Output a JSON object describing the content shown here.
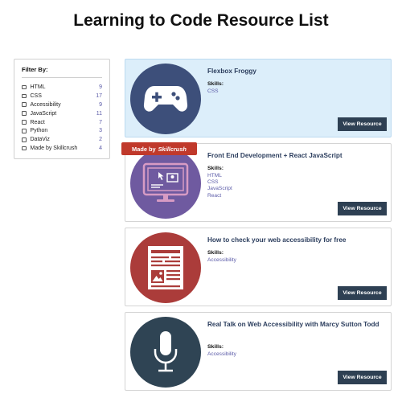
{
  "page": {
    "title": "Learning to Code Resource List"
  },
  "filter": {
    "title": "Filter By:",
    "items": [
      {
        "label": "HTML",
        "count": "9"
      },
      {
        "label": "CSS",
        "count": "17"
      },
      {
        "label": "Accessibility",
        "count": "9"
      },
      {
        "label": "JavaScript",
        "count": "11"
      },
      {
        "label": "React",
        "count": "7"
      },
      {
        "label": "Python",
        "count": "3"
      },
      {
        "label": "DataViz",
        "count": "2"
      },
      {
        "label": "Made by Skillcrush",
        "count": "4"
      }
    ]
  },
  "badge": {
    "prefix": "Made by",
    "brand": "Skillcrush"
  },
  "resources": [
    {
      "title": "Flexbox Froggy",
      "skills_heading": "Skills:",
      "skills": [
        "CSS"
      ],
      "button": "View Resource",
      "icon": "gamepad-icon",
      "icon_color": "#3d4f7a"
    },
    {
      "title": "Front End Development + React JavaScript",
      "skills_heading": "Skills:",
      "skills": [
        "HTML",
        "CSS",
        "JavaScript",
        "React"
      ],
      "button": "View Resource",
      "icon": "monitor-icon",
      "icon_color": "#6f5aa0"
    },
    {
      "title": "How to check your web accessibility for free",
      "skills_heading": "Skills:",
      "skills": [
        "Accessibility"
      ],
      "button": "View Resource",
      "icon": "document-icon",
      "icon_color": "#ab3c3a"
    },
    {
      "title": "Real Talk on Web Accessibility with Marcy Sutton Todd",
      "skills_heading": "Skills:",
      "skills": [
        "Accessibility"
      ],
      "button": "View Resource",
      "icon": "microphone-icon",
      "icon_color": "#2f4454"
    }
  ],
  "colors": {
    "highlight": "#dceefa",
    "button": "#2e4053",
    "badge": "#c0392b",
    "link": "#5b5ba8"
  }
}
